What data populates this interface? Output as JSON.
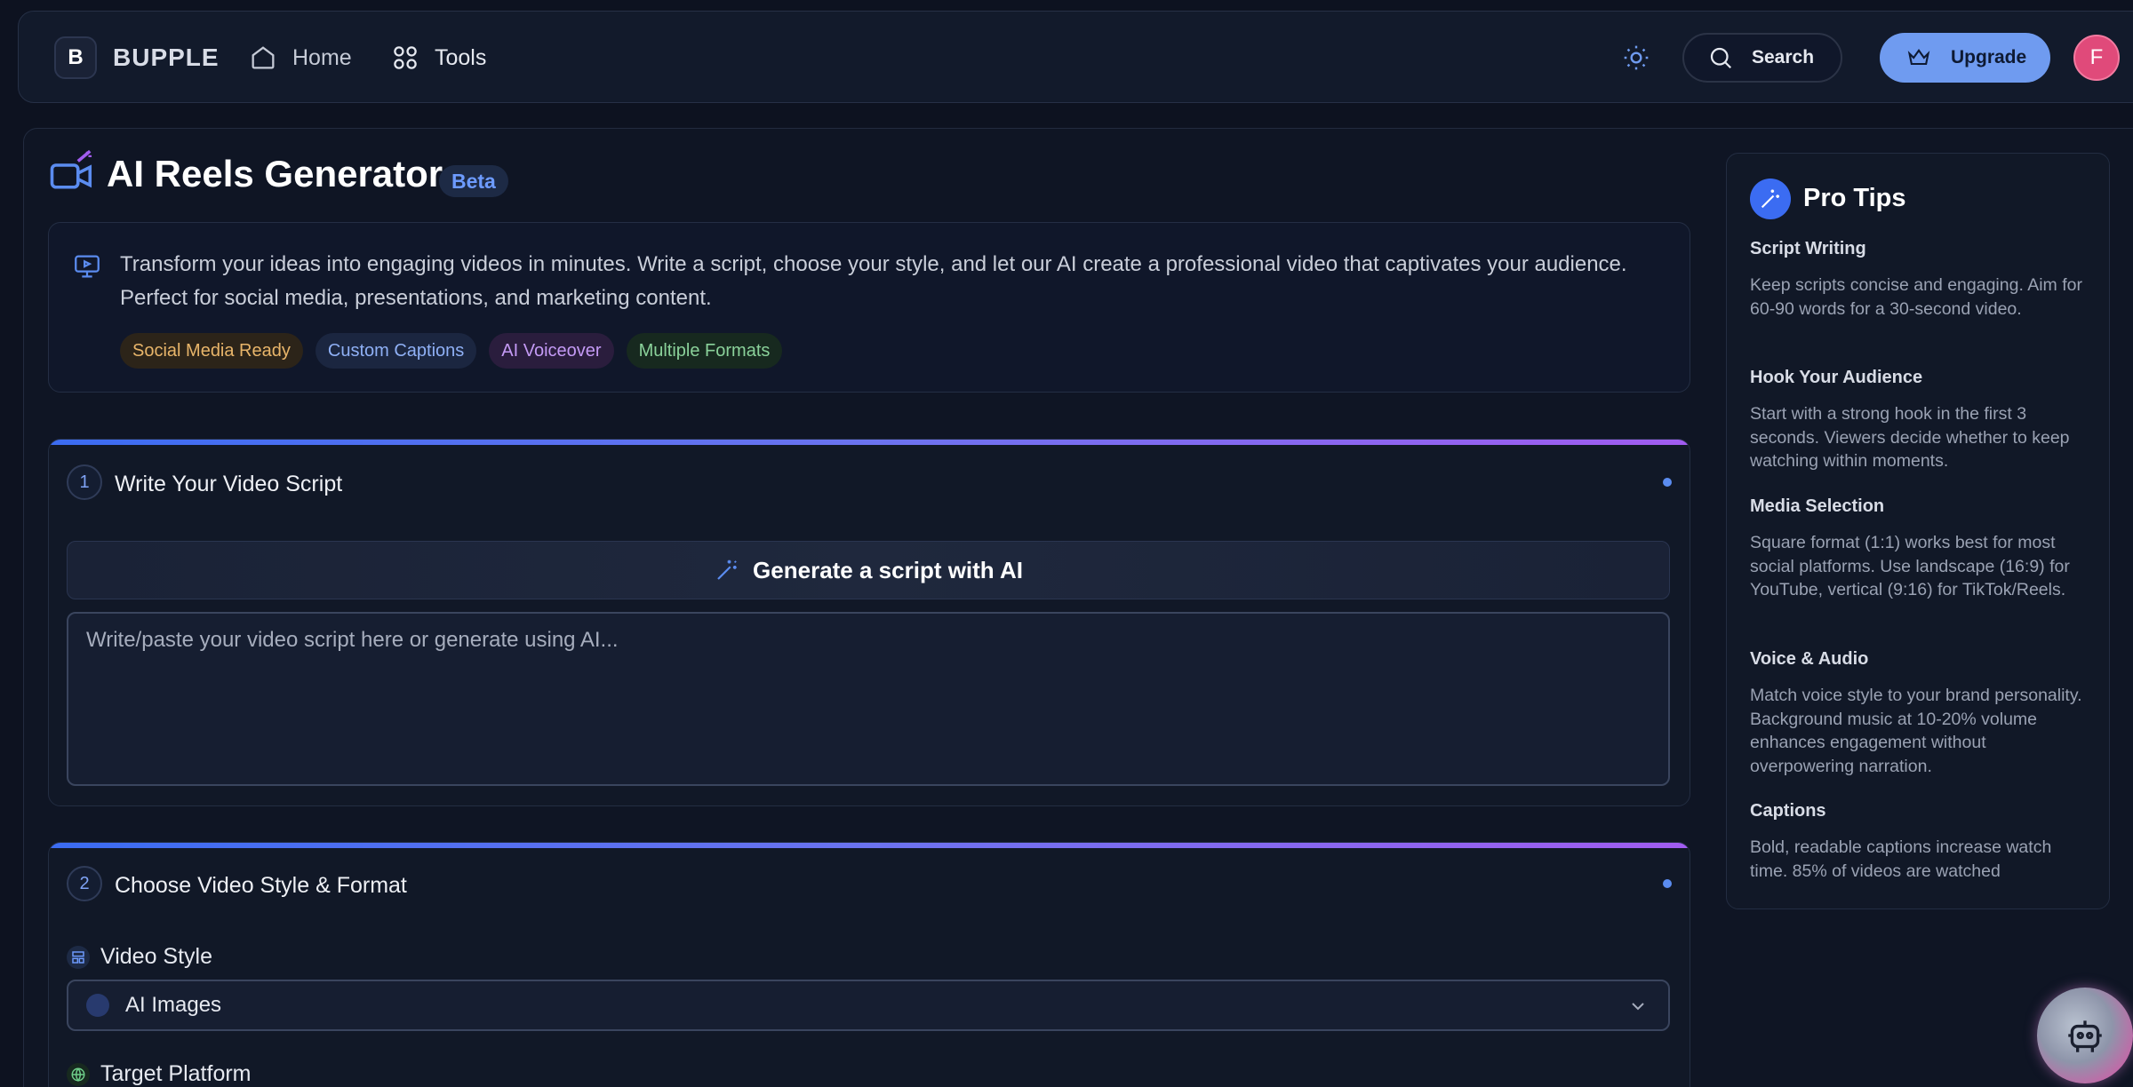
{
  "app": {
    "logo_letter": "B",
    "name": "BUPPLE"
  },
  "nav": {
    "home": "Home",
    "tools": "Tools"
  },
  "header": {
    "search": "Search",
    "upgrade": "Upgrade",
    "avatar_initial": "F"
  },
  "page": {
    "title": "AI Reels Generator",
    "badge": "Beta",
    "intro": "Transform your ideas into engaging videos in minutes. Write a script, choose your style, and let our AI create a professional video that captivates your audience. Perfect for social media, presentations, and marketing content.",
    "chips": [
      {
        "label": "Social Media Ready",
        "color": "#e8b56a",
        "bg": "#2c2419"
      },
      {
        "label": "Custom Captions",
        "color": "#8fb0f5",
        "bg": "#1b2640"
      },
      {
        "label": "AI Voiceover",
        "color": "#c49af5",
        "bg": "#2a1d3d"
      },
      {
        "label": "Multiple Formats",
        "color": "#8ad19a",
        "bg": "#17291f"
      }
    ]
  },
  "step1": {
    "number": "1",
    "title": "Write Your Video Script",
    "generate_label": "Generate a script with AI",
    "script_placeholder": "Write/paste your video script here or generate using AI..."
  },
  "step2": {
    "number": "2",
    "title": "Choose Video Style & Format",
    "style_label": "Video Style",
    "style_value": "AI Images",
    "platform_label": "Target Platform"
  },
  "tips": {
    "title": "Pro Tips",
    "items": [
      {
        "heading": "Script Writing",
        "body": "Keep scripts concise and engaging. Aim for 60-90 words for a 30-second video."
      },
      {
        "heading": "Hook Your Audience",
        "body": "Start with a strong hook in the first 3 seconds. Viewers decide whether to keep watching within moments."
      },
      {
        "heading": "Media Selection",
        "body": "Square format (1:1) works best for most social platforms. Use landscape (16:9) for YouTube, vertical (9:16) for TikTok/Reels."
      },
      {
        "heading": "Voice & Audio",
        "body": "Match voice style to your brand personality. Background music at 10-20% volume enhances engagement without overpowering narration."
      },
      {
        "heading": "Captions",
        "body": "Bold, readable captions increase watch time. 85% of videos are watched"
      }
    ]
  },
  "colors": {
    "accent": "#5b8cf0",
    "upgrade": "#6f9bf0",
    "avatar": "#e04a7a"
  }
}
